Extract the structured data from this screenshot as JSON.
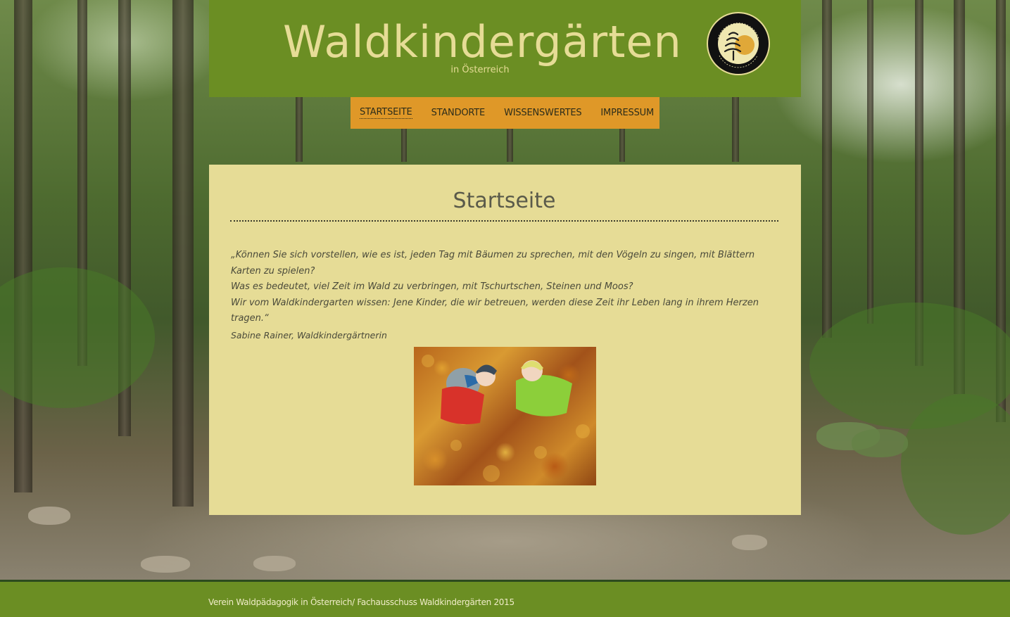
{
  "header": {
    "title": "Waldkindergärten",
    "subtitle": "in Österreich",
    "logo_icon": "waldpaedagogik-logo-icon"
  },
  "nav": {
    "items": [
      {
        "label": "STARTSEITE",
        "active": true
      },
      {
        "label": "STANDORTE",
        "active": false
      },
      {
        "label": "WISSENSWERTES",
        "active": false
      },
      {
        "label": "IMPRESSUM",
        "active": false
      }
    ]
  },
  "main": {
    "heading": "Startseite",
    "quote_lines": [
      "„Können Sie sich vorstellen, wie es ist, jeden Tag mit Bäumen zu sprechen, mit den Vögeln zu singen, mit Blättern Karten zu spielen?",
      "Was es bedeutet, viel Zeit im Wald zu verbringen, mit Tschurtschen, Steinen und Moos?",
      "Wir vom Waldkindergarten wissen: Jene Kinder, die wir betreuen, werden diese Zeit ihr Leben lang in ihrem Herzen tragen.“"
    ],
    "author": "Sabine Rainer, Waldkindergärtnerin"
  },
  "footer": {
    "text": "Verein Waldpädagogik in Österreich/ Fachausschuss Waldkindergärten 2015"
  },
  "colors": {
    "header_green": "#6b8e23",
    "title_cream": "#e6dc96",
    "nav_orange": "#df9828",
    "content_bg": "#e6dc96"
  }
}
